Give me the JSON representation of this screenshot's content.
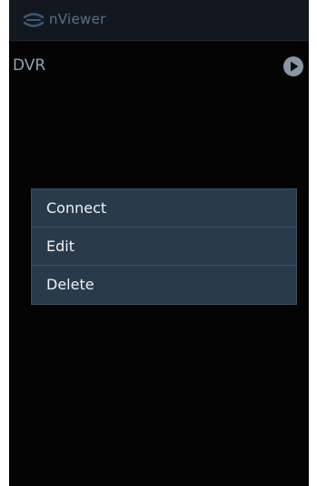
{
  "app": {
    "title": "nViewer",
    "logo_icon": "nviewer-logo-icon"
  },
  "device_list": {
    "items": [
      {
        "name": "DVR",
        "action_icon": "play-icon"
      }
    ]
  },
  "context_menu": {
    "items": [
      {
        "label": "Connect"
      },
      {
        "label": "Edit"
      },
      {
        "label": "Delete"
      }
    ]
  },
  "colors": {
    "background": "#040405",
    "titlebar": "#131820",
    "menu_background": "#293a4b",
    "menu_text": "#eef2f6",
    "device_text": "#93a1b3"
  }
}
